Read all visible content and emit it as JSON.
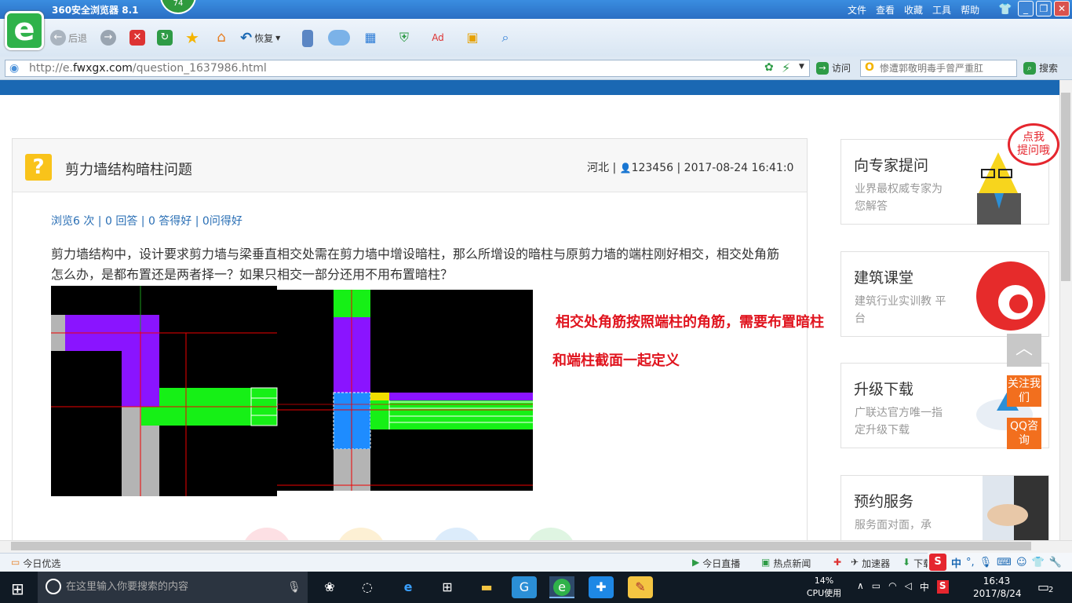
{
  "browser": {
    "app_title": "360安全浏览器 8.1",
    "badge_num": "74",
    "menus": [
      "文件",
      "查看",
      "收藏",
      "工具",
      "帮助"
    ],
    "back_label": "后退",
    "restore_label": "恢复",
    "url_prefix": "http://e.",
    "url_domain": "fwxgx.com",
    "url_path": "/question_1637986.html",
    "visit_label": "访问",
    "search_placeholder": "惨遭郭敬明毒手曾严重肛",
    "search_label": "搜索"
  },
  "question": {
    "title": "剪力墙结构暗柱问题",
    "region": "河北",
    "user": "123456",
    "datetime": "2017-08-24 16:41:0",
    "stats": "浏览6 次 | 0 回答 | 0 答得好 | 0问得好",
    "body": "剪力墙结构中，设计要求剪力墙与梁垂直相交处需在剪力墙中增设暗柱，那么所增设的暗柱与原剪力墙的端柱刚好相交，相交处角筋怎么办，是都布置还是两者择一？如果只相交一部分还用不用布置暗柱？",
    "note1": "相交处角筋按照端柱的角筋，需要布置暗柱",
    "note2": "和端柱截面一起定义"
  },
  "sidebar": {
    "ask_title": "向专家提问",
    "ask_sub": "业界最权威专家为您解答",
    "bubble": "点我\n提问哦",
    "class_title": "建筑课堂",
    "class_sub": "建筑行业实训教 平台",
    "download_title": "升级下载",
    "download_sub": "广联达官方唯一指定升级下载",
    "service_title": "预约服务",
    "service_sub": "服务面对面，承"
  },
  "float": {
    "follow": "关注我们",
    "qq": "QQ咨询"
  },
  "statusbar": {
    "today": "今日优选",
    "live": "今日直播",
    "news": "热点新闻",
    "accel": "加速器",
    "download": "下载",
    "ime": "中"
  },
  "taskbar": {
    "search_placeholder": "在这里输入你要搜索的内容",
    "cpu_pct": "14%",
    "cpu_label": "CPU使用",
    "lang": "中",
    "time": "16:43",
    "date": "2017/8/24",
    "notif": "2"
  },
  "colors": {
    "brand_blue": "#1a68b3",
    "accent_orange": "#f26f1e",
    "note_red": "#e0141e"
  }
}
